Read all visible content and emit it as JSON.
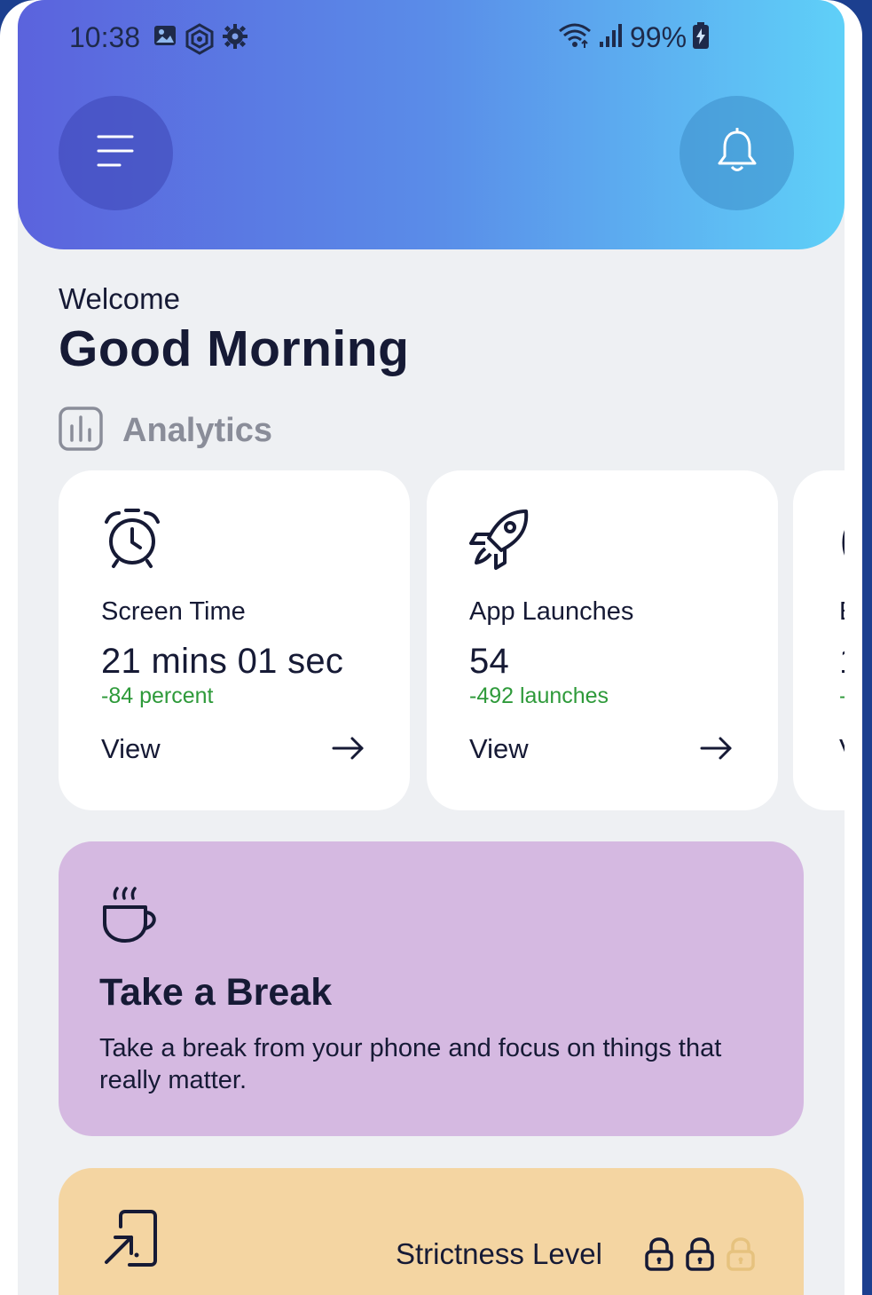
{
  "status_bar": {
    "time": "10:38",
    "battery": "99%",
    "left_icons": [
      "image-icon",
      "vpn-shield-icon",
      "settings-gear-icon"
    ],
    "right_icons": [
      "wifi-icon",
      "signal-icon",
      "battery-charging-icon"
    ]
  },
  "header": {
    "menu_icon": "menu-icon",
    "bell_icon": "bell-icon",
    "gradient_start": "#5b63dd",
    "gradient_end": "#5fd0f8"
  },
  "greeting": {
    "welcome": "Welcome",
    "title": "Good Morning"
  },
  "analytics": {
    "title": "Analytics",
    "icon": "bar-chart-icon",
    "cards": [
      {
        "icon": "alarm-clock-icon",
        "label": "Screen Time",
        "value": "21 mins 01 sec",
        "delta": "-84 percent",
        "action": "View"
      },
      {
        "icon": "rocket-icon",
        "label": "App Launches",
        "value": "54",
        "delta": "-492 launches",
        "action": "View"
      }
    ],
    "peek_card": {
      "label_start": "E",
      "value_start": "1",
      "delta_start": "-",
      "action_start": "V"
    }
  },
  "break_card": {
    "icon": "coffee-cup-icon",
    "title": "Take a Break",
    "description": "Take a break from your phone and focus on things that really matter.",
    "color": "#d5b9e1"
  },
  "strictness_card": {
    "icon": "open-app-icon",
    "label": "Strictness Level",
    "locks": [
      {
        "icon": "lock-icon",
        "active": true
      },
      {
        "icon": "lock-icon",
        "active": true
      },
      {
        "icon": "lock-icon",
        "active": false
      }
    ],
    "color": "#f4d5a2"
  },
  "colors": {
    "positive_delta": "#2e9a3a",
    "text_primary": "#161a35",
    "muted": "#8a8d99"
  }
}
